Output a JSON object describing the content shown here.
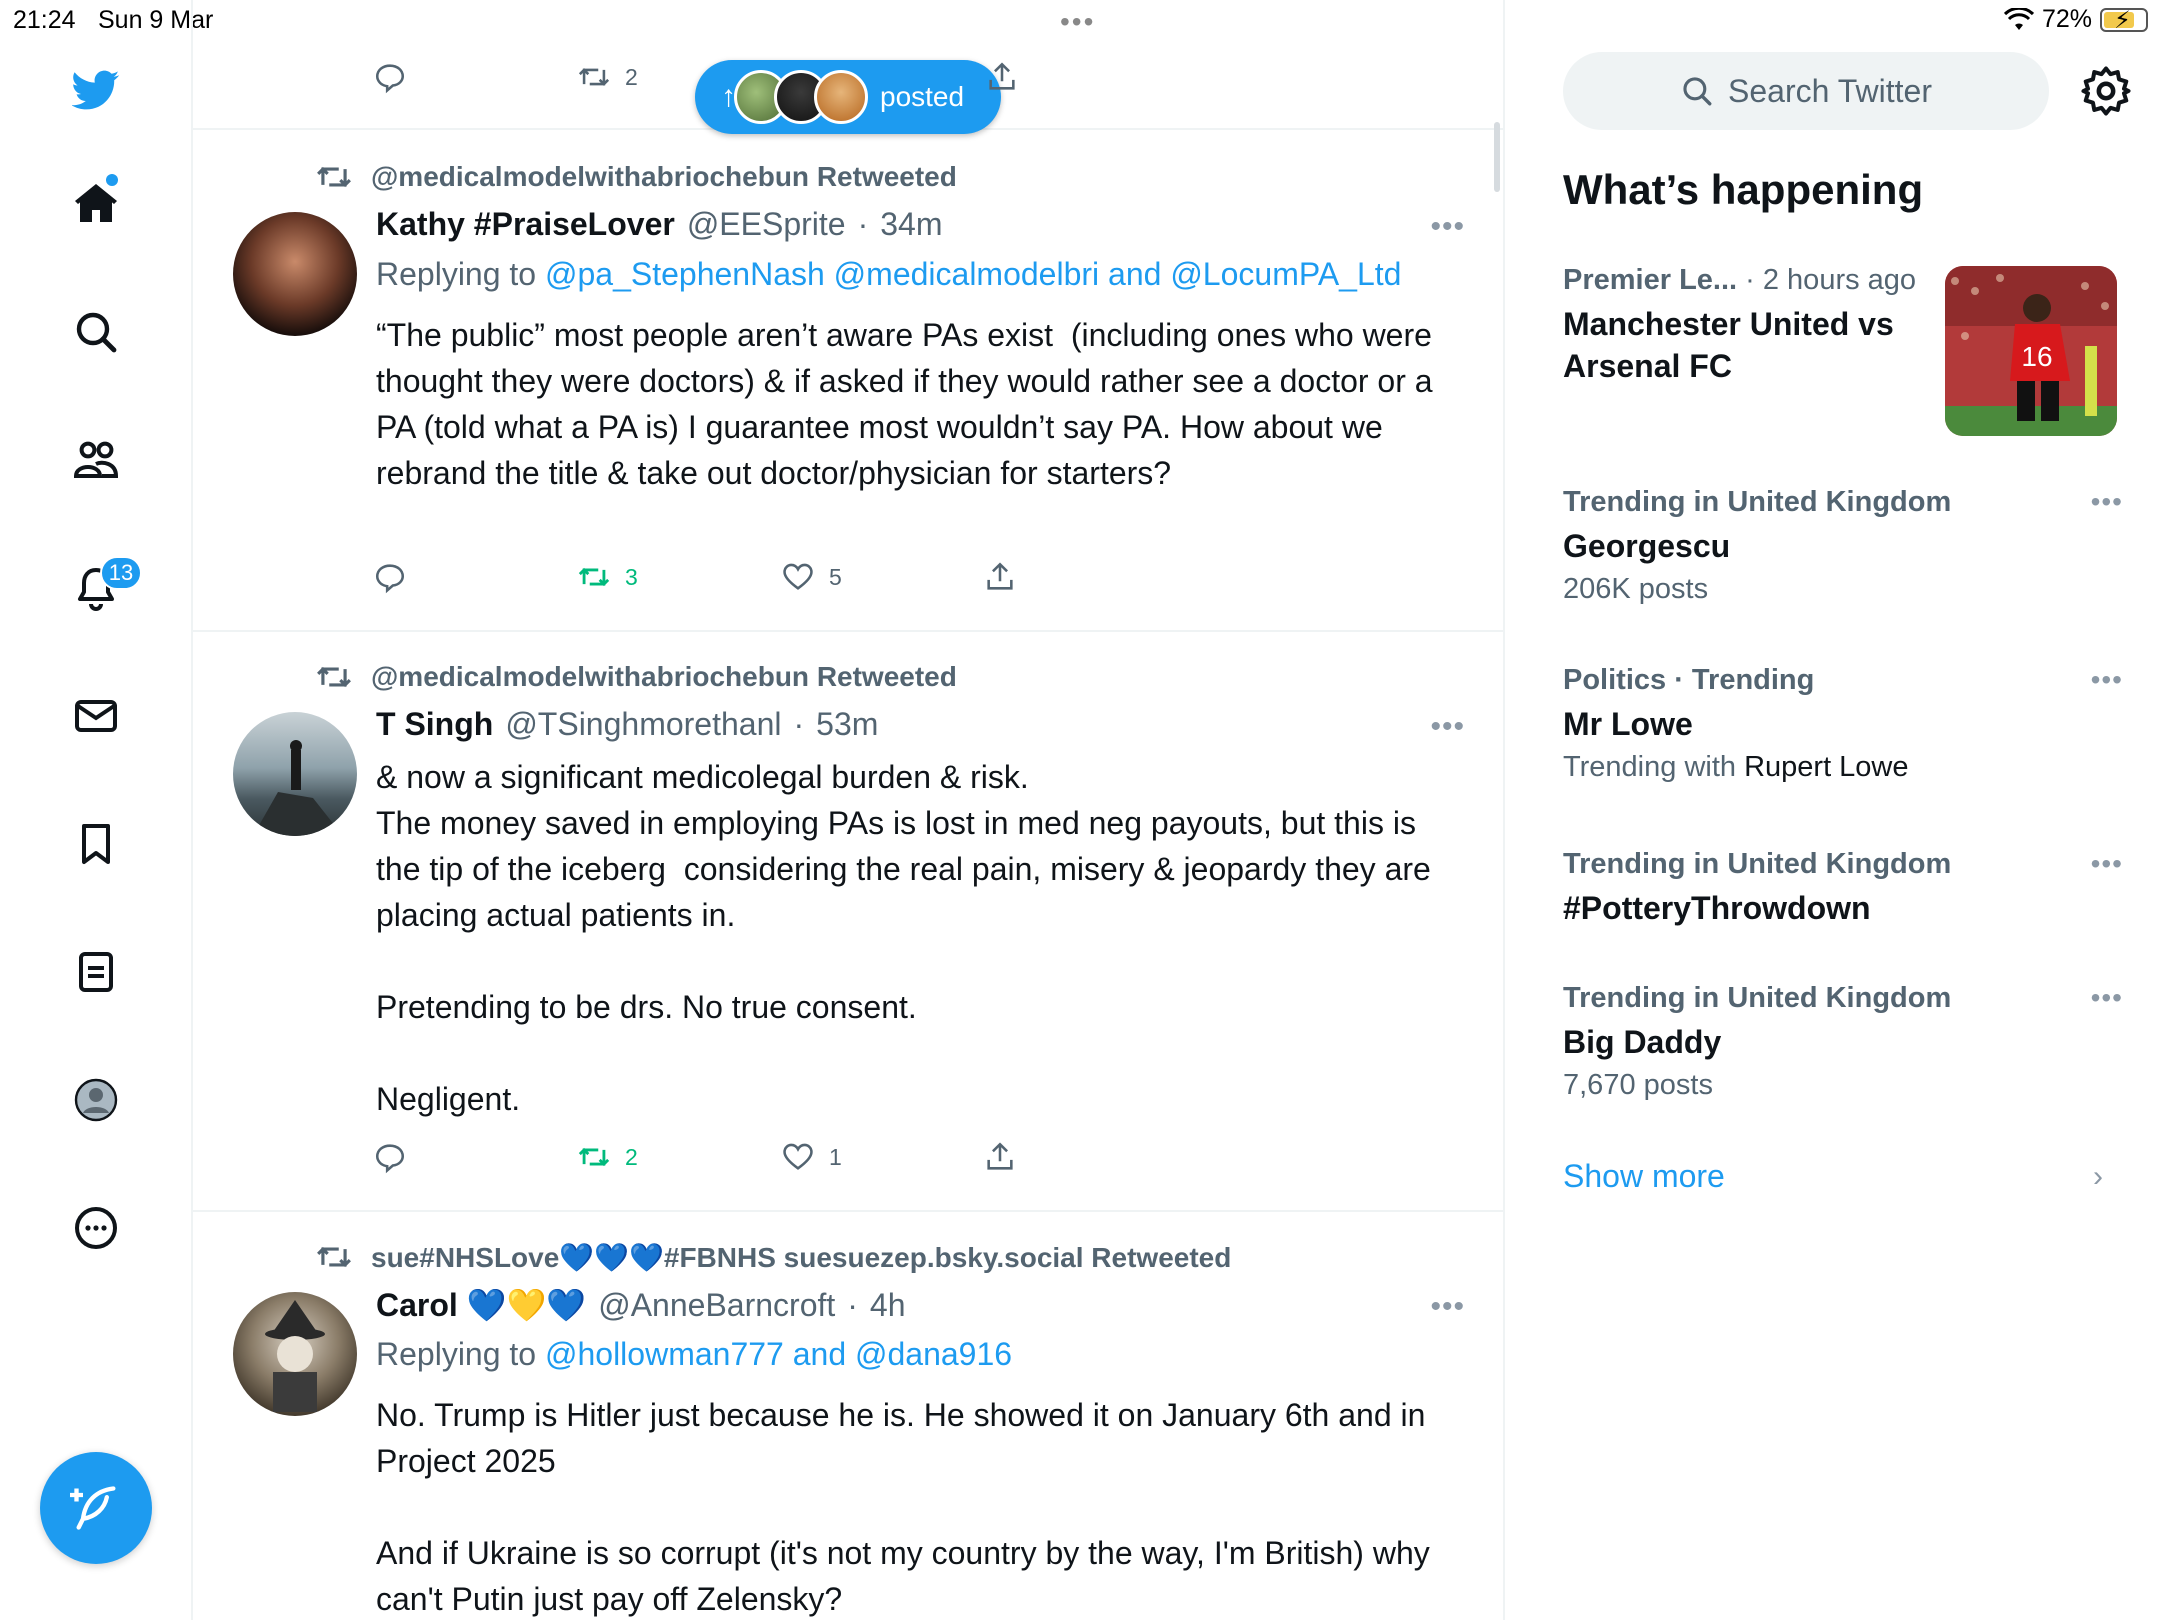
{
  "status_bar": {
    "time": "21:24",
    "date": "Sun 9 Mar",
    "battery": "72%"
  },
  "nav": {
    "notifications_badge": "13"
  },
  "top_row": {
    "retweets": "2"
  },
  "new_posts_pill": {
    "label": "posted"
  },
  "tweets": [
    {
      "retweeted_by": "@medicalmodelwithabriochebun Retweeted",
      "name": "Kathy #PraiseLover",
      "handle": "@EESprite",
      "time": "34m",
      "replying_prefix": "Replying to",
      "replying_to": "@pa_StephenNash @medicalmodelbri and @LocumPA_Ltd",
      "text": "“The public” most people aren’t aware PAs exist  (including ones who were thought they were doctors) & if asked if they would rather see a doctor or a PA (told what a PA is) I guarantee most wouldn’t say PA. How about we rebrand the title & take out doctor/physician for starters?",
      "retweets": "3",
      "likes": "5"
    },
    {
      "retweeted_by": "@medicalmodelwithabriochebun Retweeted",
      "name": "T Singh",
      "handle": "@TSinghmorethanl",
      "time": "53m",
      "text": "& now a significant medicolegal burden & risk.\nThe money saved in employing PAs is lost in med neg payouts, but this is the tip of the iceberg  considering the real pain, misery & jeopardy they are placing actual patients in.\n\nPretending to be drs. No true consent.\n\nNegligent.",
      "retweets": "2",
      "likes": "1"
    },
    {
      "retweeted_by": "sue#NHSLove💙💙💙#FBNHS suesuezep.bsky.social Retweeted",
      "name": "Carol 💙💛💙",
      "handle": "@AnneBarncroft",
      "time": "4h",
      "replying_prefix": "Replying to",
      "replying_to": "@hollowman777 and @dana916",
      "text": "No. Trump is Hitler just because he is. He showed it on January 6th and in Project 2025\n\nAnd if Ukraine is so corrupt (it's not my country by the way, I'm British) why can't Putin just pay off Zelensky?"
    }
  ],
  "sidebar": {
    "search_placeholder": "Search Twitter",
    "whats_happening": "What’s happening",
    "trends": [
      {
        "meta": "Premier Le...",
        "meta2": "· 2 hours ago",
        "title": "Manchester United vs Arsenal FC"
      },
      {
        "meta": "Trending in United Kingdom",
        "title": "Georgescu",
        "sub": "206K posts"
      },
      {
        "meta": "Politics · Trending",
        "title": "Mr Lowe",
        "sub_prefix": "Trending with",
        "sub_dark": "Rupert Lowe"
      },
      {
        "meta": "Trending in United Kingdom",
        "title": "#PotteryThrowdown"
      },
      {
        "meta": "Trending in United Kingdom",
        "title": "Big Daddy",
        "sub": "7,670 posts"
      }
    ],
    "show_more": "Show more"
  },
  "colors": {
    "accent": "#1d9bf0",
    "retweet_green": "#00ba7c",
    "muted": "#536471"
  }
}
